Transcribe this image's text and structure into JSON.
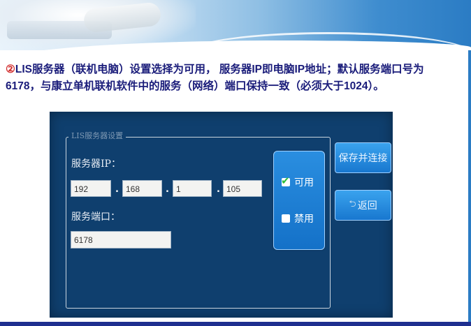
{
  "slide": {
    "description_num": "②",
    "description_text": "LIS服务器（联机电脑）设置选择为可用， 服务器IP即电脑IP地址；默认服务端口号为6178，与康立单机联机软件中的服务（网络）端口保持一致（必须大于1024）。"
  },
  "settings_screen": {
    "group_title": "LIS服务器设置",
    "server_ip_label": "服务器IP：",
    "ip_octets": [
      "192",
      "168",
      "1",
      "105"
    ],
    "dot": ".",
    "port_label": "服务端口：",
    "port_value": "6178",
    "options": {
      "enable": {
        "label": "可用",
        "checked": true
      },
      "disable": {
        "label": "禁用",
        "checked": false
      }
    },
    "save_button": "保存并连接",
    "back_button": "返回"
  }
}
